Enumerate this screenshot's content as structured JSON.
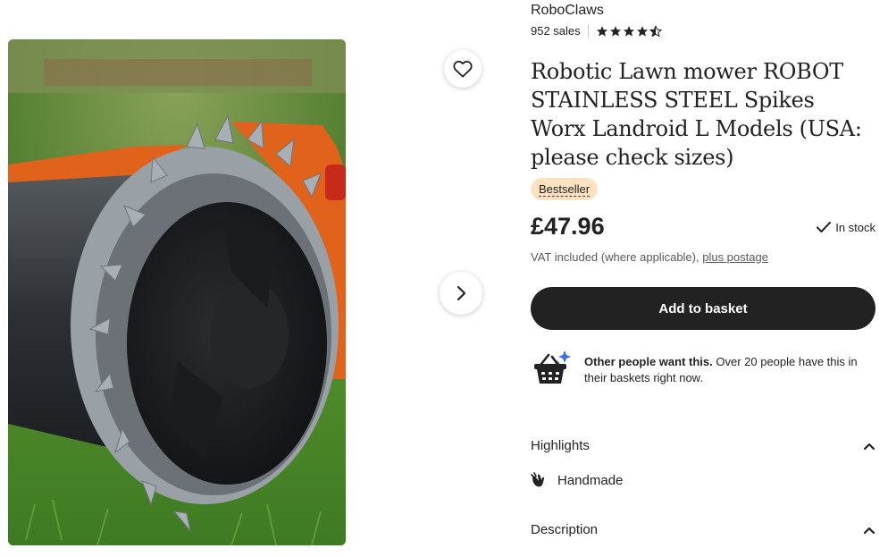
{
  "shop": {
    "name": "RoboClaws",
    "sales": "952 sales",
    "rating": 4.5,
    "stars_icon": "star-icon"
  },
  "product": {
    "title": "Robotic Lawn mower ROBOT STAINLESS STEEL Spikes Worx Landroid L Models (USA: please check sizes)",
    "badge": "Bestseller",
    "price": "£47.96",
    "stock": "In stock",
    "vat_text": "VAT included (where applicable), ",
    "postage_link": "plus postage"
  },
  "actions": {
    "add_to_basket": "Add to basket",
    "favourite_icon": "heart-icon",
    "next_image_icon": "chevron-right-icon"
  },
  "demand": {
    "lead": "Other people want this.",
    "text": " Over 20 people have this in their baskets right now."
  },
  "highlights": {
    "heading": "Highlights",
    "items": [
      {
        "label": "Handmade",
        "icon": "hand-icon"
      }
    ]
  },
  "description": {
    "heading": "Description"
  },
  "colors": {
    "button_bg": "#222222",
    "badge_bg": "#fde2c2",
    "basket_accent": "#3d6fe0"
  }
}
